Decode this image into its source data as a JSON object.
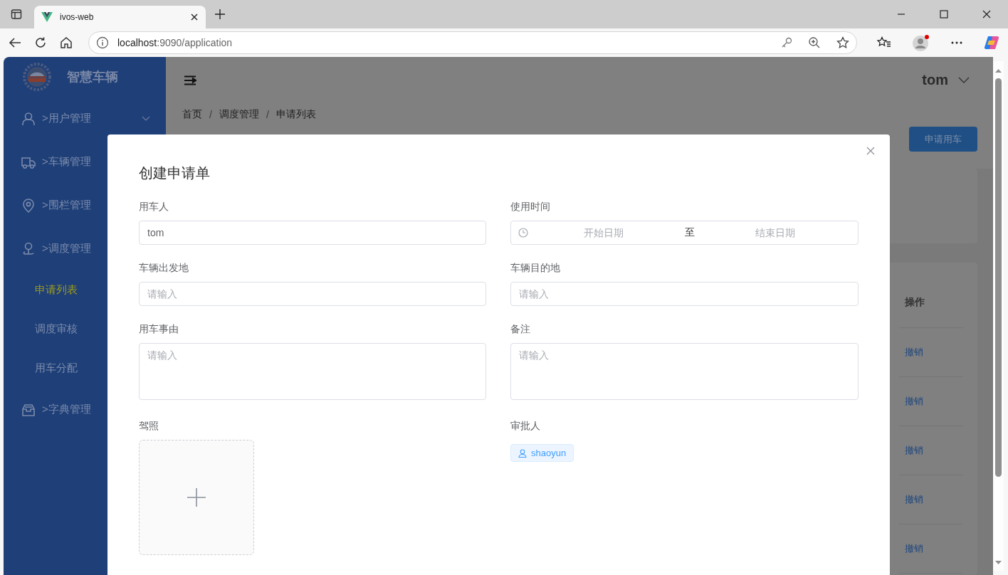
{
  "browser": {
    "tab_title": "ivos-web",
    "url_host": "localhost",
    "url_rest": ":9090/application"
  },
  "sidebar": {
    "app_title": "智慧车辆",
    "menu": [
      {
        "label": ">用户管理",
        "kind": "user",
        "arrow": true
      },
      {
        "label": ">车辆管理",
        "kind": "truck"
      },
      {
        "label": ">围栏管理",
        "kind": "pin"
      },
      {
        "label": ">调度管理",
        "kind": "person-pin",
        "children": [
          {
            "label": "申请列表",
            "selected": true
          },
          {
            "label": "调度审核",
            "selected": false
          },
          {
            "label": "用车分配",
            "selected": false
          }
        ]
      },
      {
        "label": ">字典管理",
        "kind": "box"
      }
    ]
  },
  "header": {
    "user": "tom"
  },
  "breadcrumb": [
    {
      "label": "首页",
      "separator": "/"
    },
    {
      "label": "调度管理",
      "separator": "/"
    },
    {
      "label": "申请列表"
    }
  ],
  "primary_button": "申请用车",
  "table": {
    "columns": [
      "操作"
    ],
    "rows": [
      {
        "action": "撤销"
      },
      {
        "action": "撤销"
      },
      {
        "action": "撤销"
      },
      {
        "action": "撤销"
      },
      {
        "action": "撤销"
      }
    ]
  },
  "dialog": {
    "title": "创建申请单",
    "fields": [
      {
        "kind": "text",
        "label": "用车人",
        "value": "tom"
      },
      {
        "kind": "daterange",
        "label": "使用时间",
        "start_placeholder": "开始日期",
        "separator": "至",
        "end_placeholder": "结束日期"
      },
      {
        "kind": "text",
        "label": "车辆出发地",
        "placeholder": "请输入"
      },
      {
        "kind": "text",
        "label": "车辆目的地",
        "placeholder": "请输入"
      },
      {
        "kind": "textarea",
        "label": "用车事由",
        "placeholder": "请输入"
      },
      {
        "kind": "textarea",
        "label": "备注",
        "placeholder": "请输入"
      },
      {
        "kind": "upload",
        "label": "驾照"
      },
      {
        "kind": "tag",
        "label": "审批人",
        "value": "shaoyun"
      }
    ]
  }
}
